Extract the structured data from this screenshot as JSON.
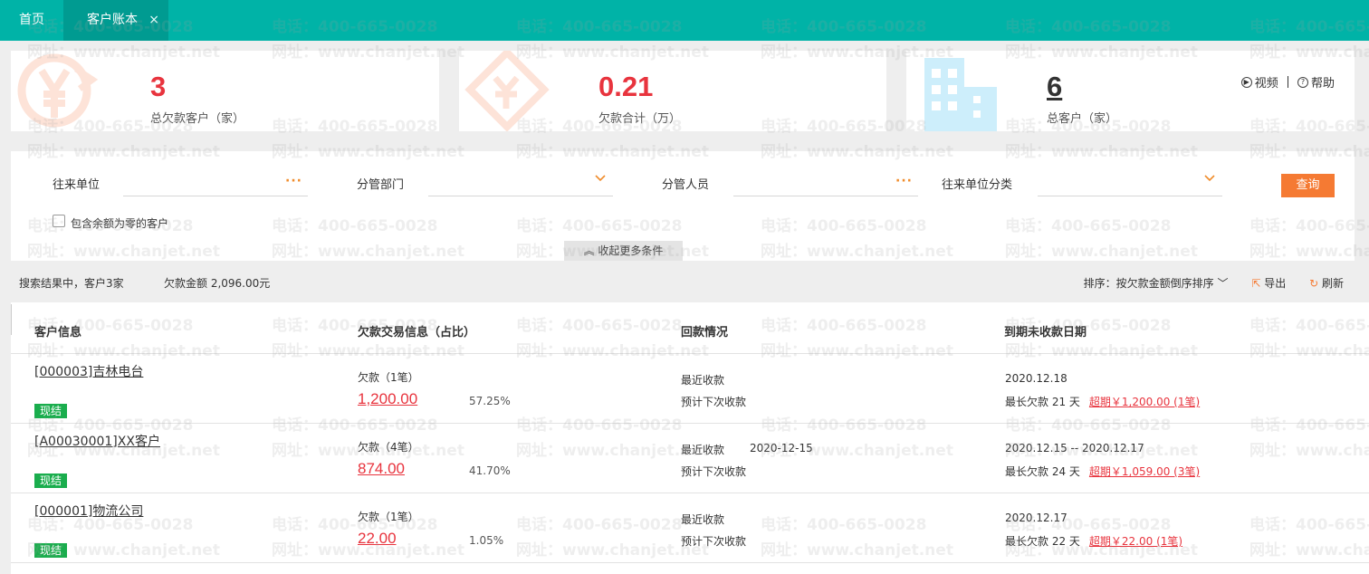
{
  "tabs": {
    "home": "首页",
    "active": "客户账本",
    "close": "×"
  },
  "summary": {
    "cards": [
      {
        "value": "3",
        "label": "总欠款客户（家）"
      },
      {
        "value": "0.21",
        "label": "欠款合计（万）"
      },
      {
        "value": "6",
        "label": "总客户（家）"
      }
    ],
    "video": "视频",
    "help": "帮助"
  },
  "filters": {
    "partner_label": "往来单位",
    "dept_label": "分管部门",
    "staff_label": "分管人员",
    "category_label": "往来单位分类",
    "dots": "···",
    "query_button": "查询",
    "include_zero": "包含余额为零的客户",
    "collapse": "收起更多条件"
  },
  "result": {
    "summary": "搜索结果中，客户3家",
    "amount": "欠款金额 2,096.00元",
    "sort": "排序：按欠款金额倒序排序",
    "export": "导出",
    "refresh": "刷新"
  },
  "table": {
    "headers": [
      "客户信息",
      "欠款交易信息（占比）",
      "回款情况",
      "到期未收款日期"
    ],
    "rows": [
      {
        "customer": "[000003]吉林电台",
        "badge": "现结",
        "debt_label": "欠款（1笔）",
        "debt_amount": "1,200.00",
        "percent": "57.25%",
        "last_pay_label": "最近收款",
        "last_pay_date": "",
        "next_pay_label": "预计下次收款",
        "due_range": "2020.12.18",
        "longest": "最长欠款 21 天",
        "overdue": "超期￥1,200.00 (1笔)"
      },
      {
        "customer": "[A00030001]XX客户",
        "badge": "现结",
        "debt_label": "欠款（4笔）",
        "debt_amount": "874.00",
        "percent": "41.70%",
        "last_pay_label": "最近收款",
        "last_pay_date": "2020-12-15",
        "next_pay_label": "预计下次收款",
        "due_range": "2020.12.15 -- 2020.12.17",
        "longest": "最长欠款 24 天",
        "overdue": "超期￥1,059.00 (3笔)"
      },
      {
        "customer": "[000001]物流公司",
        "badge": "现结",
        "debt_label": "欠款（1笔）",
        "debt_amount": "22.00",
        "percent": "1.05%",
        "last_pay_label": "最近收款",
        "last_pay_date": "",
        "next_pay_label": "预计下次收款",
        "due_range": "2020.12.17",
        "longest": "最长欠款 22 天",
        "overdue": "超期￥22.00 (1笔)"
      }
    ]
  },
  "watermark": {
    "line1": "电话：400-665-0028",
    "line2": "网址：www.chanjet.net"
  },
  "colors": {
    "teal": "#00b3a7",
    "red": "#e8343e",
    "orange": "#f57a33",
    "green": "#1aad4d"
  }
}
